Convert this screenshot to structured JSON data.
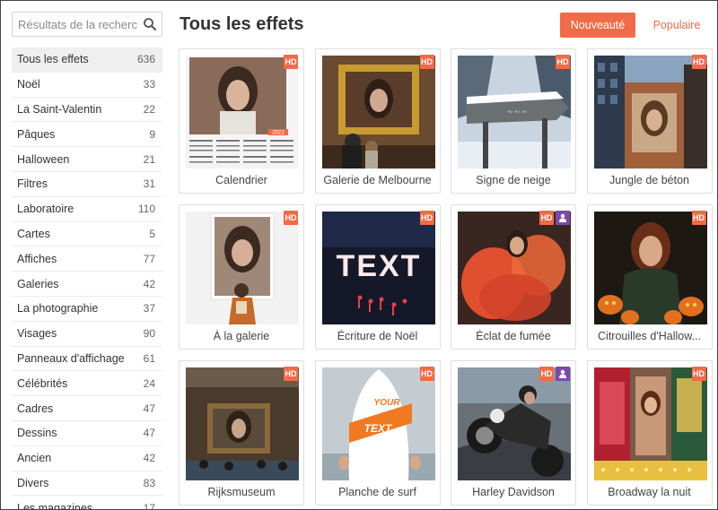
{
  "search": {
    "placeholder": "Résultats de la recherche",
    "icon": "search-icon"
  },
  "sidebar": {
    "categories": [
      {
        "label": "Tous les effets",
        "count": "636",
        "active": true
      },
      {
        "label": "Noël",
        "count": "33"
      },
      {
        "label": "La Saint-Valentin",
        "count": "22"
      },
      {
        "label": "Pâques",
        "count": "9"
      },
      {
        "label": "Halloween",
        "count": "21"
      },
      {
        "label": "Filtres",
        "count": "31"
      },
      {
        "label": "Laboratoire",
        "count": "110"
      },
      {
        "label": "Cartes",
        "count": "5"
      },
      {
        "label": "Affiches",
        "count": "77"
      },
      {
        "label": "Galeries",
        "count": "42"
      },
      {
        "label": "La photographie",
        "count": "37"
      },
      {
        "label": "Visages",
        "count": "90"
      },
      {
        "label": "Panneaux d'affichage",
        "count": "61"
      },
      {
        "label": "Célébrités",
        "count": "24"
      },
      {
        "label": "Cadres",
        "count": "47"
      },
      {
        "label": "Dessins",
        "count": "47"
      },
      {
        "label": "Ancien",
        "count": "42"
      },
      {
        "label": "Divers",
        "count": "83"
      },
      {
        "label": "Les magazines",
        "count": "17"
      }
    ]
  },
  "main": {
    "title": "Tous les effets",
    "sort": {
      "newest": "Nouveauté",
      "popular": "Populaire"
    },
    "accent_color": "#f26b47",
    "effects": [
      {
        "name": "Calendrier",
        "hd": "HD",
        "user": false,
        "thumb_text": "2022"
      },
      {
        "name": "Galerie de Melbourne",
        "hd": "HD",
        "user": false
      },
      {
        "name": "Signe de neige",
        "hd": "HD",
        "user": false
      },
      {
        "name": "Jungle de béton",
        "hd": "HD",
        "user": false
      },
      {
        "name": "À la galerie",
        "hd": "HD",
        "user": false
      },
      {
        "name": "Écriture de Noël",
        "hd": "HD",
        "user": false,
        "thumb_text": "TEXT"
      },
      {
        "name": "Éclat de fumée",
        "hd": "HD",
        "user": true
      },
      {
        "name": "Citrouilles d'Hallow...",
        "hd": "HD",
        "user": false
      },
      {
        "name": "Rijksmuseum",
        "hd": "HD",
        "user": false
      },
      {
        "name": "Planche de surf",
        "hd": "HD",
        "user": false,
        "thumb_text": [
          "YOUR",
          "TEXT"
        ]
      },
      {
        "name": "Harley Davidson",
        "hd": "HD",
        "user": true
      },
      {
        "name": "Broadway la nuit",
        "hd": "HD",
        "user": false
      }
    ]
  }
}
